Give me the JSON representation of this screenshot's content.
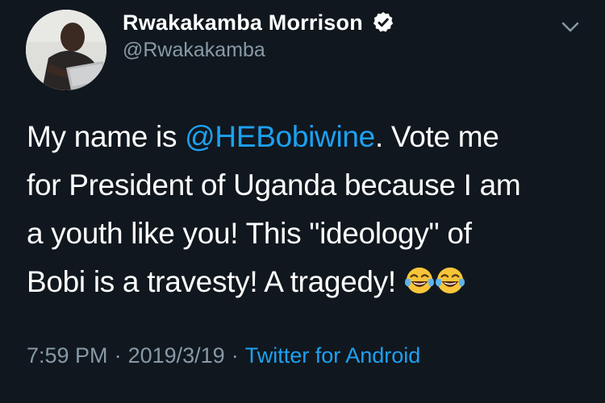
{
  "author": {
    "display_name": "Rwakakamba Morrison",
    "handle": "@Rwakakamba",
    "verified": true
  },
  "tweet": {
    "line1_before": "My name is ",
    "mention": "@HEBobiwine",
    "line1_after": ". Vote me",
    "line2": "for President of Uganda because I am",
    "line3": "a youth like you! This \"ideology\" of",
    "line4": "Bobi is a travesty! A tragedy! ",
    "emojis": [
      "face-with-tears-of-joy",
      "face-with-tears-of-joy"
    ]
  },
  "meta": {
    "time": "7:59 PM",
    "separator": "·",
    "date": "2019/3/19",
    "source": "Twitter for Android"
  },
  "colors": {
    "background": "#10171e",
    "accent": "#1da1f2",
    "secondary_text": "#8899a6"
  }
}
